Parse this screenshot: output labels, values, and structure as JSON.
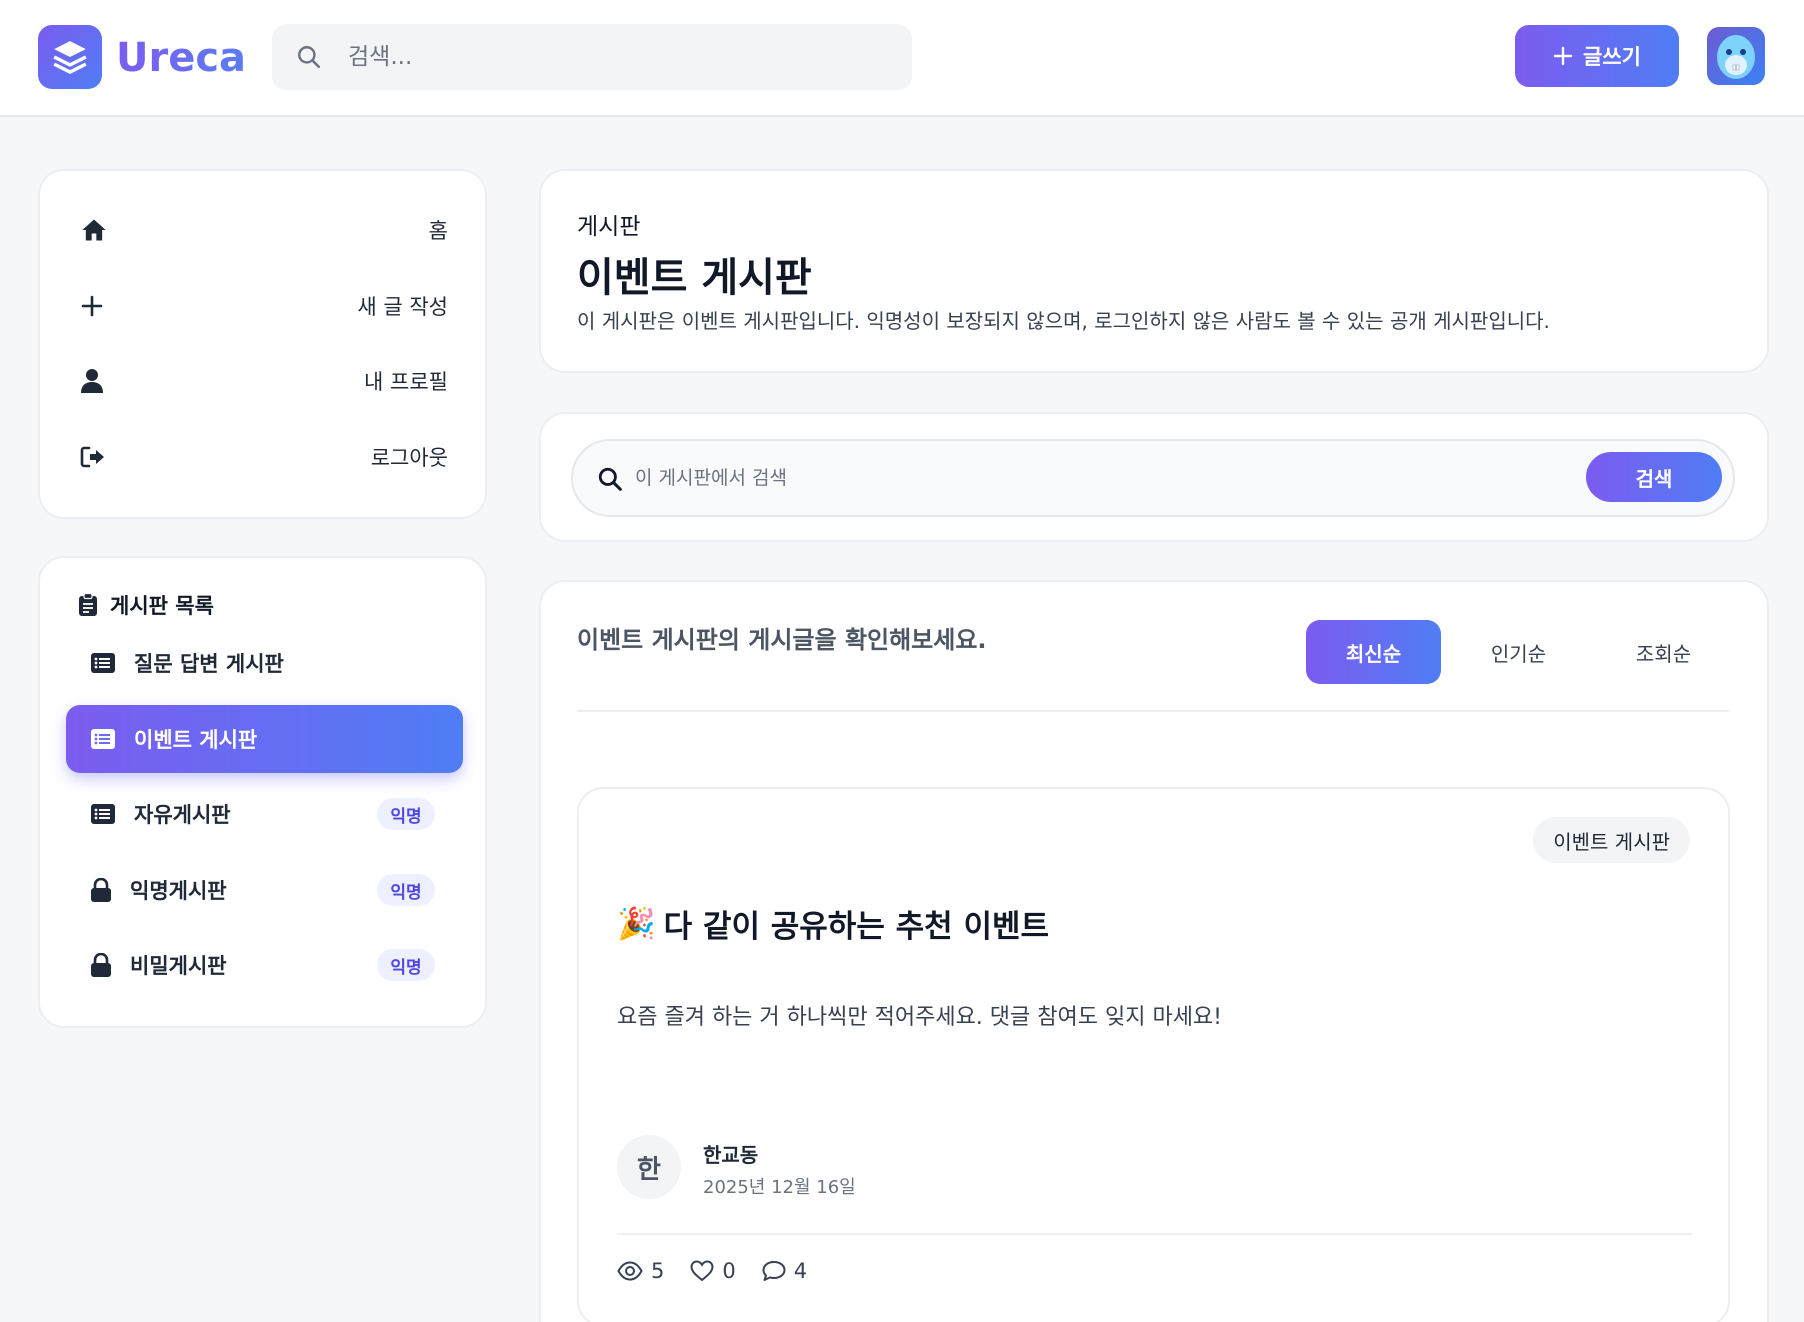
{
  "app": {
    "name": "Ureca"
  },
  "header": {
    "search_placeholder": "검색...",
    "write_label": "글쓰기"
  },
  "nav": {
    "items": [
      {
        "label": "홈",
        "icon": "home-icon"
      },
      {
        "label": "새 글 작성",
        "icon": "plus-icon"
      },
      {
        "label": "내 프로필",
        "icon": "user-icon"
      },
      {
        "label": "로그아웃",
        "icon": "logout-icon"
      }
    ]
  },
  "boards": {
    "title": "게시판 목록",
    "items": [
      {
        "label": "질문 답변 게시판",
        "icon": "list-icon",
        "badge": "",
        "active": false
      },
      {
        "label": "이벤트 게시판",
        "icon": "list-icon",
        "badge": "",
        "active": true
      },
      {
        "label": "자유게시판",
        "icon": "list-icon",
        "badge": "익명",
        "active": false
      },
      {
        "label": "익명게시판",
        "icon": "lock-icon",
        "badge": "익명",
        "active": false
      },
      {
        "label": "비밀게시판",
        "icon": "lock-icon",
        "badge": "익명",
        "active": false
      }
    ]
  },
  "board_header": {
    "breadcrumb": "게시판",
    "title": "이벤트 게시판",
    "description": "이 게시판은 이벤트 게시판입니다. 익명성이 보장되지 않으며, 로그인하지 않은 사람도 볼 수 있는 공개 게시판입니다."
  },
  "board_search": {
    "placeholder": "이 게시판에서 검색",
    "button_label": "검색"
  },
  "posts": {
    "intro": "이벤트 게시판의 게시글을 확인해보세요.",
    "sort_tabs": [
      {
        "label": "최신순",
        "active": true
      },
      {
        "label": "인기순",
        "active": false
      },
      {
        "label": "조회순",
        "active": false
      }
    ],
    "items": [
      {
        "tag": "이벤트 게시판",
        "emoji": "🎉",
        "title": "다 같이 공유하는 추천 이벤트",
        "body": "요즘 즐겨 하는 거 하나씩만 적어주세요. 댓글 참여도 잊지 마세요!",
        "author_initial": "한",
        "author": "한교동",
        "date": "2025년 12월 16일",
        "views": "5",
        "likes": "0",
        "comments": "4"
      }
    ]
  },
  "colors": {
    "accent_start": "#7c5cf0",
    "accent_end": "#4f7df6",
    "badge_bg": "#eef0ff",
    "badge_text": "#4f46e5"
  }
}
